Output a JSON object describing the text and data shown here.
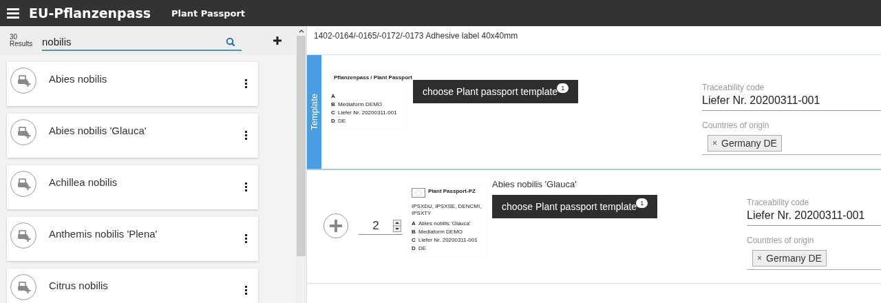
{
  "header": {
    "title": "EU-Pflanzenpass",
    "subtitle": "Plant Passport"
  },
  "search": {
    "count": "30",
    "count_label": "Results",
    "value": "nobilis"
  },
  "results": [
    {
      "name": "Abies nobilis"
    },
    {
      "name": "Abies nobilis 'Glauca'"
    },
    {
      "name": "Achillea nobilis"
    },
    {
      "name": "Anthemis nobilis 'Plena'"
    },
    {
      "name": "Citrus nobilis"
    }
  ],
  "article": {
    "title": "1402-0164/-0165/-0172/-0173 Adhesive label 40x40mm"
  },
  "template": {
    "tab": "Template",
    "label": {
      "heading": "Pflanzenpass / Plant Passport",
      "lines": [
        {
          "letter": "A"
        },
        {
          "letter": "B",
          "text": "Mediaform DEMO"
        },
        {
          "letter": "C",
          "text": "Liefer Nr. 20200311-001"
        },
        {
          "letter": "D",
          "text": "DE"
        }
      ]
    },
    "button": "choose Plant passport template",
    "badge": "1",
    "trace": {
      "label": "Traceability code",
      "value": "Liefer Nr. 20200311-001"
    },
    "origin": {
      "label": "Countries of origin",
      "tags": [
        {
          "label": "Germany DE",
          "remove": "×"
        }
      ]
    }
  },
  "rows": [
    {
      "quantity": "2",
      "name": "Abies nobilis 'Glauca'",
      "label": {
        "heading": "Plant Passport-PZ",
        "codes": "IPSXDU, IPSXSE, DENCMI, IPSXTY",
        "lines": [
          {
            "letter": "A",
            "text": "Abies nobilis 'Glauca'"
          },
          {
            "letter": "B",
            "text": "Mediaform DEMO"
          },
          {
            "letter": "C",
            "text": "Liefer Nr. 20200311-001"
          },
          {
            "letter": "D",
            "text": "DE"
          }
        ]
      },
      "button": "choose Plant passport template",
      "badge": "1",
      "trace": {
        "label": "Traceability code",
        "value": "Liefer Nr. 20200311-001"
      },
      "origin": {
        "label": "Countries of origin",
        "tags": [
          {
            "label": "Germany DE",
            "remove": "×"
          }
        ]
      }
    }
  ]
}
